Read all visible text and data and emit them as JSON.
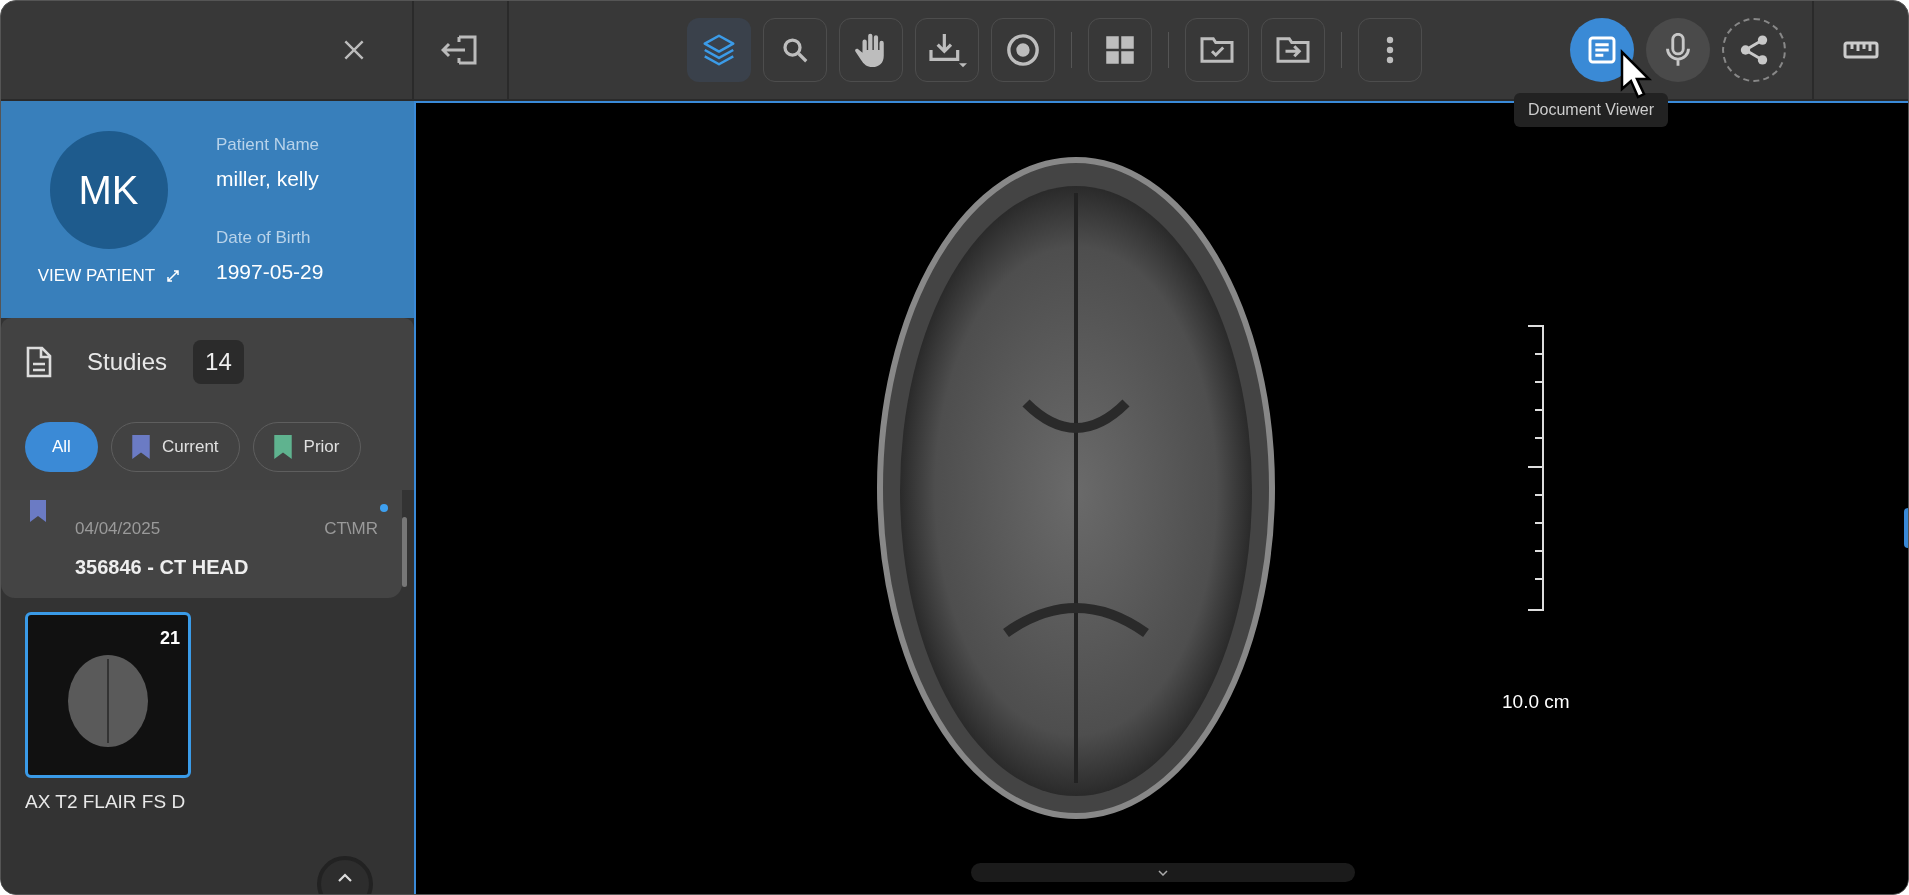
{
  "patient": {
    "initials": "MK",
    "view_patient": "VIEW PATIENT",
    "name_label": "Patient Name",
    "name": "miller, kelly",
    "dob_label": "Date of Birth",
    "dob": "1997-05-29"
  },
  "studies": {
    "title": "Studies",
    "count": "14",
    "filters": [
      {
        "label": "All",
        "selected": true
      },
      {
        "label": "Current",
        "selected": false,
        "color": "#6b7bc4"
      },
      {
        "label": "Prior",
        "selected": false,
        "color": "#5fb38f"
      }
    ],
    "items": [
      {
        "date": "04/04/2025",
        "modality": "CT\\MR",
        "title": "356846 - CT HEAD",
        "color": "#6b7bc4",
        "unread": true,
        "series": [
          {
            "label": "AX T2 FLAIR FS D",
            "count": "21",
            "selected": true
          }
        ]
      }
    ]
  },
  "toolbar": {
    "groups": [
      [
        {
          "kind": "layers",
          "selected": true
        },
        {
          "kind": "search",
          "selected": false
        },
        {
          "kind": "hand",
          "selected": false
        },
        {
          "kind": "download",
          "selected": false
        },
        {
          "kind": "target",
          "selected": false
        }
      ],
      [
        {
          "kind": "grid",
          "selected": false
        }
      ],
      [
        {
          "kind": "folder-check",
          "selected": false
        },
        {
          "kind": "folder-arrow",
          "selected": false
        }
      ],
      [
        {
          "kind": "more",
          "selected": false
        }
      ]
    ],
    "right": [
      {
        "kind": "document",
        "selected": true
      },
      {
        "kind": "microphone",
        "selected": false
      },
      {
        "kind": "share",
        "selected": false
      }
    ],
    "tooltip": "Document Viewer"
  },
  "viewer": {
    "scale_label": "10.0 cm"
  }
}
